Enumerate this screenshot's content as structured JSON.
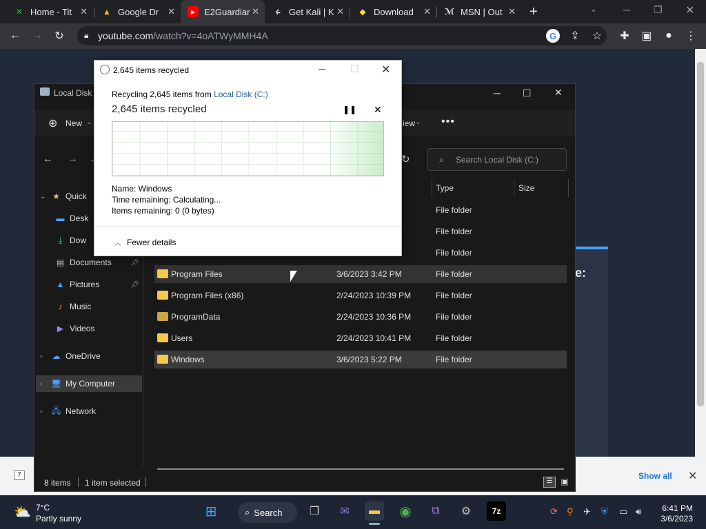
{
  "browser": {
    "tabs": [
      {
        "title": "Home - Tit",
        "icon": "x-favicon"
      },
      {
        "title": "Google Dr",
        "icon": "drive-favicon"
      },
      {
        "title": "E2Guardiar",
        "icon": "youtube-favicon"
      },
      {
        "title": "Get Kali | K",
        "icon": "kali-favicon"
      },
      {
        "title": "Download",
        "icon": "python-favicon"
      },
      {
        "title": "MSN | Out",
        "icon": "msn-favicon"
      }
    ],
    "url_host": "youtube.com",
    "url_path": "/watch?v=4oATWyMMH4A"
  },
  "explorer": {
    "title": "Local Disk",
    "new_label": "New",
    "view_label": "iew",
    "search_placeholder": "Search Local Disk (C:)",
    "nav": [
      {
        "label": "Quick",
        "icon": "star-icon"
      },
      {
        "label": "Desk",
        "icon": "desktop-icon"
      },
      {
        "label": "Dow",
        "icon": "download-icon"
      },
      {
        "label": "Documents",
        "icon": "documents-icon"
      },
      {
        "label": "Pictures",
        "icon": "pictures-icon"
      },
      {
        "label": "Music",
        "icon": "music-icon"
      },
      {
        "label": "Videos",
        "icon": "videos-icon"
      },
      {
        "label": "OneDrive",
        "icon": "cloud-icon"
      },
      {
        "label": "My Computer",
        "icon": "computer-icon"
      },
      {
        "label": "Network",
        "icon": "network-icon"
      }
    ],
    "columns": {
      "type": "Type",
      "size": "Size"
    },
    "partial_rows": [
      "File folder",
      "File folder",
      "File folder"
    ],
    "rows": [
      {
        "name": "Program Files",
        "date": "3/6/2023 3:42 PM",
        "type": "File folder"
      },
      {
        "name": "Program Files (x86)",
        "date": "2/24/2023 10:39 PM",
        "type": "File folder"
      },
      {
        "name": "ProgramData",
        "date": "2/24/2023 10:36 PM",
        "type": "File folder"
      },
      {
        "name": "Users",
        "date": "2/24/2023 10:41 PM",
        "type": "File folder"
      },
      {
        "name": "Windows",
        "date": "3/6/2023 5:22 PM",
        "type": "File folder"
      }
    ],
    "status_items": "8 items",
    "status_selected": "1 item selected"
  },
  "dialog": {
    "title": "2,645 items recycled",
    "from_prefix": "Recycling 2,645 items from ",
    "from_link": "Local Disk (C:)",
    "headline": "2,645 items recycled",
    "name_label": "Name:  Windows",
    "time_label": "Time remaining:  Calculating...",
    "items_label": "Items remaining:  0 (0 bytes)",
    "fewer": "Fewer details"
  },
  "downloads": {
    "show_all": "Show all"
  },
  "taskbar": {
    "temp": "7°C",
    "weather": "Partly sunny",
    "search": "Search",
    "time": "6:41 PM",
    "date": "3/6/2023"
  },
  "colors": {
    "accent": "#1a73e8",
    "taskbar": "#1d2433",
    "explorer_bg": "#191919"
  }
}
